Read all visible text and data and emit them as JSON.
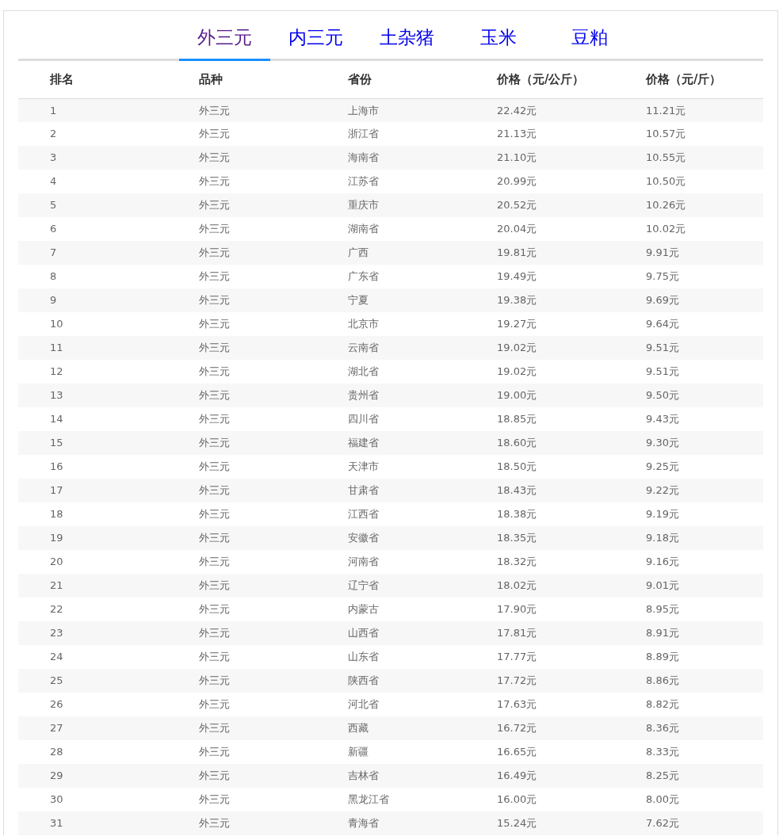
{
  "tabs": [
    {
      "label": "外三元",
      "selected": true
    },
    {
      "label": "内三元",
      "selected": false
    },
    {
      "label": "土杂猪",
      "selected": false
    },
    {
      "label": "玉米",
      "selected": false
    },
    {
      "label": "豆粕",
      "selected": false
    }
  ],
  "table": {
    "columns": [
      "排名",
      "品种",
      "省份",
      "价格（元/公斤）",
      "价格（元/斤）"
    ],
    "rows": [
      [
        "1",
        "外三元",
        "上海市",
        "22.42元",
        "11.21元"
      ],
      [
        "2",
        "外三元",
        "浙江省",
        "21.13元",
        "10.57元"
      ],
      [
        "3",
        "外三元",
        "海南省",
        "21.10元",
        "10.55元"
      ],
      [
        "4",
        "外三元",
        "江苏省",
        "20.99元",
        "10.50元"
      ],
      [
        "5",
        "外三元",
        "重庆市",
        "20.52元",
        "10.26元"
      ],
      [
        "6",
        "外三元",
        "湖南省",
        "20.04元",
        "10.02元"
      ],
      [
        "7",
        "外三元",
        "广西",
        "19.81元",
        "9.91元"
      ],
      [
        "8",
        "外三元",
        "广东省",
        "19.49元",
        "9.75元"
      ],
      [
        "9",
        "外三元",
        "宁夏",
        "19.38元",
        "9.69元"
      ],
      [
        "10",
        "外三元",
        "北京市",
        "19.27元",
        "9.64元"
      ],
      [
        "11",
        "外三元",
        "云南省",
        "19.02元",
        "9.51元"
      ],
      [
        "12",
        "外三元",
        "湖北省",
        "19.02元",
        "9.51元"
      ],
      [
        "13",
        "外三元",
        "贵州省",
        "19.00元",
        "9.50元"
      ],
      [
        "14",
        "外三元",
        "四川省",
        "18.85元",
        "9.43元"
      ],
      [
        "15",
        "外三元",
        "福建省",
        "18.60元",
        "9.30元"
      ],
      [
        "16",
        "外三元",
        "天津市",
        "18.50元",
        "9.25元"
      ],
      [
        "17",
        "外三元",
        "甘肃省",
        "18.43元",
        "9.22元"
      ],
      [
        "18",
        "外三元",
        "江西省",
        "18.38元",
        "9.19元"
      ],
      [
        "19",
        "外三元",
        "安徽省",
        "18.35元",
        "9.18元"
      ],
      [
        "20",
        "外三元",
        "河南省",
        "18.32元",
        "9.16元"
      ],
      [
        "21",
        "外三元",
        "辽宁省",
        "18.02元",
        "9.01元"
      ],
      [
        "22",
        "外三元",
        "内蒙古",
        "17.90元",
        "8.95元"
      ],
      [
        "23",
        "外三元",
        "山西省",
        "17.81元",
        "8.91元"
      ],
      [
        "24",
        "外三元",
        "山东省",
        "17.77元",
        "8.89元"
      ],
      [
        "25",
        "外三元",
        "陕西省",
        "17.72元",
        "8.86元"
      ],
      [
        "26",
        "外三元",
        "河北省",
        "17.63元",
        "8.82元"
      ],
      [
        "27",
        "外三元",
        "西藏",
        "16.72元",
        "8.36元"
      ],
      [
        "28",
        "外三元",
        "新疆",
        "16.65元",
        "8.33元"
      ],
      [
        "29",
        "外三元",
        "吉林省",
        "16.49元",
        "8.25元"
      ],
      [
        "30",
        "外三元",
        "黑龙江省",
        "16.00元",
        "8.00元"
      ],
      [
        "31",
        "外三元",
        "青海省",
        "15.24元",
        "7.62元"
      ]
    ]
  }
}
